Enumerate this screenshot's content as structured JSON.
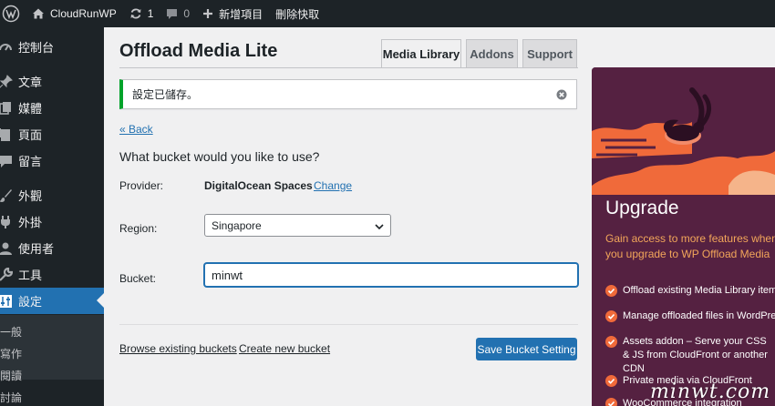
{
  "adminbar": {
    "site_name": "CloudRunWP",
    "updates_count": "1",
    "comments_count": "0",
    "new_label": "新增項目",
    "purge_label": "刪除快取"
  },
  "sidebar": {
    "items": [
      {
        "label": "控制台",
        "icon": "dashboard-icon"
      },
      {
        "label": "文章",
        "icon": "pin-icon"
      },
      {
        "label": "媒體",
        "icon": "media-icon"
      },
      {
        "label": "頁面",
        "icon": "page-icon"
      },
      {
        "label": "留言",
        "icon": "comment-icon"
      },
      {
        "label": "外觀",
        "icon": "brush-icon"
      },
      {
        "label": "外掛",
        "icon": "plugin-icon"
      },
      {
        "label": "使用者",
        "icon": "user-icon"
      },
      {
        "label": "工具",
        "icon": "wrench-icon"
      },
      {
        "label": "設定",
        "icon": "settings-icon"
      }
    ],
    "submenu": [
      "一般",
      "寫作",
      "閱讀",
      "討論"
    ]
  },
  "page": {
    "title": "Offload Media Lite",
    "tabs": [
      "Media Library",
      "Addons",
      "Support"
    ],
    "notice": "設定已儲存。",
    "back_link": "« Back",
    "question": "What bucket would you like to use?",
    "provider_label": "Provider:",
    "provider_value": "DigitalOcean Spaces",
    "change_link": "Change",
    "region_label": "Region:",
    "region_value": "Singapore",
    "bucket_label": "Bucket:",
    "bucket_value": "minwt",
    "browse_link": "Browse existing buckets",
    "create_link": "Create new bucket",
    "save_button": "Save Bucket Setting"
  },
  "upgrade": {
    "title": "Upgrade",
    "description": "Gain access to more features when you upgrade to WP Offload Media",
    "features": [
      "Offload existing Media Library items",
      "Manage offloaded files in WordPress",
      "Assets addon – Serve your CSS & JS from CloudFront or another CDN",
      "Private media via CloudFront",
      "WooCommerce integration"
    ]
  },
  "watermark": "minwt.com",
  "colors": {
    "admin_dark": "#1d2327",
    "wp_blue": "#2271b1",
    "success_green": "#00a32a",
    "upgrade_bg": "#552141",
    "upgrade_orange": "#f06a3a"
  }
}
